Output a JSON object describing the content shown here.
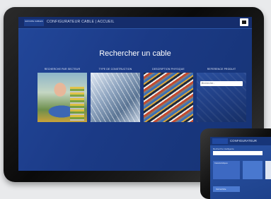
{
  "header": {
    "brand_text": "GROUPE CABLES",
    "title": "CONFIGURATEUR CABLE | ACCUEIL",
    "menu_icon": "square-menu-icon"
  },
  "main": {
    "title": "Rechercher un cable",
    "categories": [
      {
        "label": "RECHERCHE PAR SECTEUR",
        "image": "technician-photo"
      },
      {
        "label": "TYPE DE CONSTRUCTION",
        "image": "building-photo"
      },
      {
        "label": "DESCRIPTION PHYSIQUE",
        "image": "cables-photo"
      },
      {
        "label": "REFERENCE PRODUIT",
        "image": "search-panel"
      }
    ],
    "search_placeholder": "Rechercher...",
    "search_icon": "chevron-down-icon"
  },
  "secondary_tablet": {
    "title": "CONFIGURATEUR",
    "field_label": "Recherche intelligente",
    "block_label": "Caracteristiques",
    "button_label": "Voir la fiche"
  },
  "colors": {
    "screen_bg": "#1b3a86",
    "header_bg": "#152d6c",
    "bezel": "#0a0a0a"
  }
}
